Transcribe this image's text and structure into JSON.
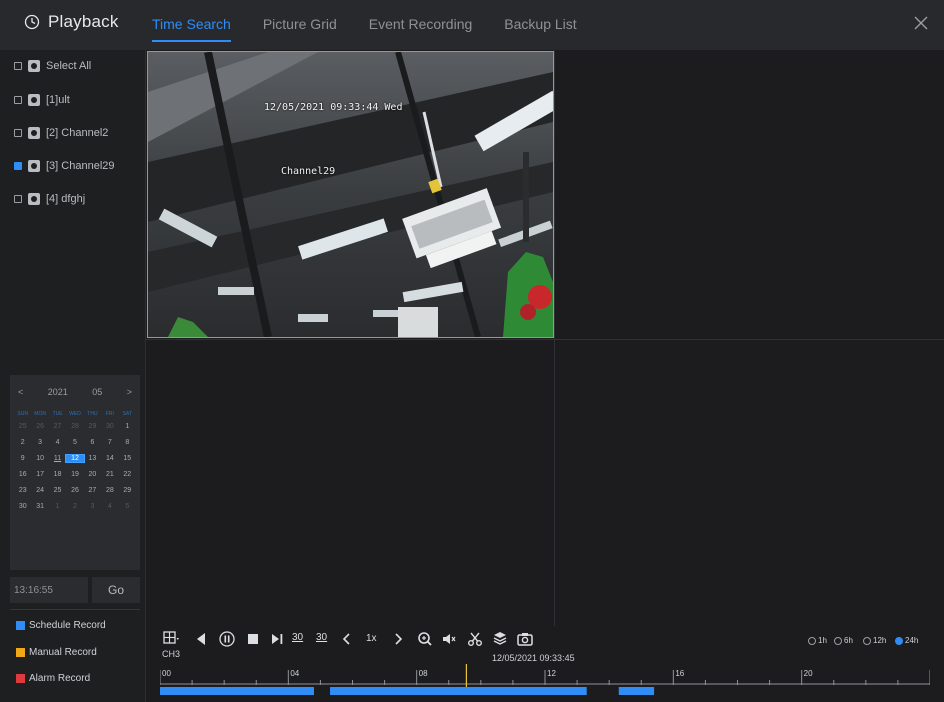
{
  "header": {
    "title": "Playback",
    "tabs": [
      {
        "label": "Time Search",
        "active": true
      },
      {
        "label": "Picture Grid",
        "active": false
      },
      {
        "label": "Event Recording",
        "active": false
      },
      {
        "label": "Backup List",
        "active": false
      }
    ],
    "accent_color": "#2f8df5"
  },
  "sidebar": {
    "select_all": "Select All",
    "channels": [
      {
        "label": "[1]ult",
        "checked": false
      },
      {
        "label": "[2] Channel2",
        "checked": false
      },
      {
        "label": "[3] Channel29",
        "checked": true
      },
      {
        "label": "[4] dfghj",
        "checked": false
      }
    ],
    "calendar": {
      "year": "2021",
      "month": "05",
      "prev": "<",
      "next": ">",
      "weekdays": [
        "SUN",
        "MON",
        "TUE",
        "WED",
        "THU",
        "FRI",
        "SAT"
      ],
      "days": [
        {
          "d": "25",
          "dim": true
        },
        {
          "d": "26",
          "dim": true
        },
        {
          "d": "27",
          "dim": true
        },
        {
          "d": "28",
          "dim": true
        },
        {
          "d": "29",
          "dim": true
        },
        {
          "d": "30",
          "dim": true
        },
        {
          "d": "1"
        },
        {
          "d": "2"
        },
        {
          "d": "3"
        },
        {
          "d": "4"
        },
        {
          "d": "5"
        },
        {
          "d": "6"
        },
        {
          "d": "7"
        },
        {
          "d": "8"
        },
        {
          "d": "9"
        },
        {
          "d": "10"
        },
        {
          "d": "11",
          "today": true
        },
        {
          "d": "12",
          "selected": true
        },
        {
          "d": "13"
        },
        {
          "d": "14"
        },
        {
          "d": "15"
        },
        {
          "d": "16"
        },
        {
          "d": "17"
        },
        {
          "d": "18"
        },
        {
          "d": "19"
        },
        {
          "d": "20"
        },
        {
          "d": "21"
        },
        {
          "d": "22"
        },
        {
          "d": "23"
        },
        {
          "d": "24"
        },
        {
          "d": "25"
        },
        {
          "d": "26"
        },
        {
          "d": "27"
        },
        {
          "d": "28"
        },
        {
          "d": "29"
        },
        {
          "d": "30"
        },
        {
          "d": "31"
        },
        {
          "d": "1",
          "dim": true
        },
        {
          "d": "2",
          "dim": true
        },
        {
          "d": "3",
          "dim": true
        },
        {
          "d": "4",
          "dim": true
        },
        {
          "d": "5",
          "dim": true
        }
      ]
    },
    "goto_value": "13:16:55",
    "goto_button": "Go",
    "legend": [
      {
        "label": "Schedule Record",
        "color": "#2f8df5"
      },
      {
        "label": "Manual Record",
        "color": "#f0a818"
      },
      {
        "label": "Alarm Record",
        "color": "#e0393e"
      }
    ]
  },
  "video": {
    "osd_datetime": "12/05/2021  09:33:44  Wed",
    "osd_channel": "Channel29"
  },
  "controls": {
    "split_label": "CH3",
    "back30": "30",
    "fwd30": "30",
    "speed": "1x",
    "current_time": "12/05/2021 09:33:45",
    "ranges": [
      {
        "label": "1h",
        "on": false
      },
      {
        "label": "6h",
        "on": false
      },
      {
        "label": "12h",
        "on": false
      },
      {
        "label": "24h",
        "on": true
      }
    ],
    "hour_labels": [
      "00",
      "04",
      "08",
      "12",
      "16",
      "20"
    ],
    "segments": [
      {
        "start": 0.0,
        "end": 4.8
      },
      {
        "start": 5.3,
        "end": 13.3
      },
      {
        "start": 14.3,
        "end": 15.4
      }
    ],
    "cursor_hour": 9.55
  }
}
